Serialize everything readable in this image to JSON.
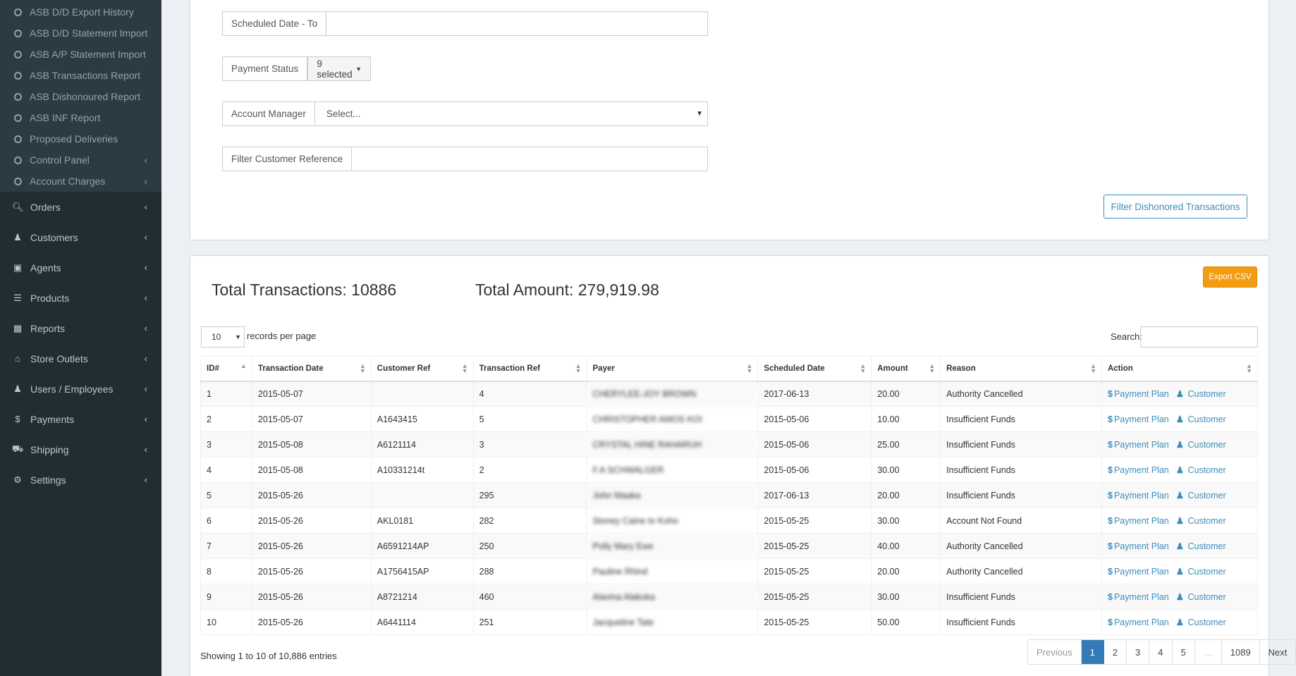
{
  "sidebar": {
    "sub_items": [
      {
        "label": "ASB D/D Export History"
      },
      {
        "label": "ASB D/D Statement Import"
      },
      {
        "label": "ASB A/P Statement Import"
      },
      {
        "label": "ASB Transactions Report"
      },
      {
        "label": "ASB Dishonoured Report"
      },
      {
        "label": "ASB INF Report"
      },
      {
        "label": "Proposed Deliveries"
      },
      {
        "label": "Control Panel"
      },
      {
        "label": "Account Charges"
      }
    ],
    "nav_items": [
      {
        "label": "Orders",
        "icon": "search-icon"
      },
      {
        "label": "Customers",
        "icon": "users-icon"
      },
      {
        "label": "Agents",
        "icon": "briefcase-icon"
      },
      {
        "label": "Products",
        "icon": "barcode-icon"
      },
      {
        "label": "Reports",
        "icon": "bar-chart-icon"
      },
      {
        "label": "Store Outlets",
        "icon": "home-icon"
      },
      {
        "label": "Users / Employees",
        "icon": "user-group-icon"
      },
      {
        "label": "Payments",
        "icon": "dollar-icon"
      },
      {
        "label": "Shipping",
        "icon": "truck-icon"
      },
      {
        "label": "Settings",
        "icon": "cogs-icon"
      }
    ]
  },
  "filters": {
    "scheduled_to_label": "Scheduled Date - To",
    "scheduled_to_value": "",
    "payment_status_label": "Payment Status",
    "payment_status_value": "9 selected",
    "account_manager_label": "Account Manager",
    "account_manager_value": "Select...",
    "customer_ref_label": "Filter Customer Reference",
    "customer_ref_value": "",
    "submit_label": "Filter Dishonored Transactions"
  },
  "results": {
    "total_transactions": "Total Transactions: 10886",
    "total_amount": "Total Amount: 279,919.98",
    "export_label": "Export CSV",
    "page_length": "10",
    "page_length_label": "records per page",
    "search_label": "Search:",
    "columns": [
      "ID#",
      "Transaction Date",
      "Customer Ref",
      "Transaction Ref",
      "Payer",
      "Scheduled Date",
      "Amount",
      "Reason",
      "Action"
    ],
    "rows": [
      {
        "id": "1",
        "tdate": "2015-05-07",
        "cref": "",
        "tref": "4",
        "payer": "CHERYLEE-JOY BROWN",
        "sdate": "2017-06-13",
        "amount": "20.00",
        "reason": "Authority Cancelled"
      },
      {
        "id": "2",
        "tdate": "2015-05-07",
        "cref": "A1643415",
        "tref": "5",
        "payer": "CHRISTOPHER AMOS KOI",
        "sdate": "2015-05-06",
        "amount": "10.00",
        "reason": "Insufficient Funds"
      },
      {
        "id": "3",
        "tdate": "2015-05-08",
        "cref": "A6121114",
        "tref": "3",
        "payer": "CRYSTAL HINE RAHARUH",
        "sdate": "2015-05-06",
        "amount": "25.00",
        "reason": "Insufficient Funds"
      },
      {
        "id": "4",
        "tdate": "2015-05-08",
        "cref": "A10331214t",
        "tref": "2",
        "payer": "F.A SCHWALGER",
        "sdate": "2015-05-06",
        "amount": "30.00",
        "reason": "Insufficient Funds"
      },
      {
        "id": "5",
        "tdate": "2015-05-26",
        "cref": "",
        "tref": "295",
        "payer": "John Maaka",
        "sdate": "2017-06-13",
        "amount": "20.00",
        "reason": "Insufficient Funds"
      },
      {
        "id": "6",
        "tdate": "2015-05-26",
        "cref": "AKL0181",
        "tref": "282",
        "payer": "Stoney Caine to Koho",
        "sdate": "2015-05-25",
        "amount": "30.00",
        "reason": "Account Not Found"
      },
      {
        "id": "7",
        "tdate": "2015-05-26",
        "cref": "A6591214AP",
        "tref": "250",
        "payer": "Polly Mary Ewe",
        "sdate": "2015-05-25",
        "amount": "40.00",
        "reason": "Authority Cancelled"
      },
      {
        "id": "8",
        "tdate": "2015-05-26",
        "cref": "A1756415AP",
        "tref": "288",
        "payer": "Pauline Rhind",
        "sdate": "2015-05-25",
        "amount": "20.00",
        "reason": "Authority Cancelled"
      },
      {
        "id": "9",
        "tdate": "2015-05-26",
        "cref": "A8721214",
        "tref": "460",
        "payer": "Alavina Alakoka",
        "sdate": "2015-05-25",
        "amount": "30.00",
        "reason": "Insufficient Funds"
      },
      {
        "id": "10",
        "tdate": "2015-05-26",
        "cref": "A6441114",
        "tref": "251",
        "payer": "Jacqueline Tate",
        "sdate": "2015-05-25",
        "amount": "50.00",
        "reason": "Insufficient Funds"
      }
    ],
    "action_payment_plan": "Payment Plan",
    "action_customer": "Customer",
    "info": "Showing 1 to 10 of 10,886 entries",
    "pagination": {
      "previous": "Previous",
      "pages": [
        "1",
        "2",
        "3",
        "4",
        "5"
      ],
      "ellipsis": "…",
      "last": "1089",
      "next": "Next"
    }
  }
}
